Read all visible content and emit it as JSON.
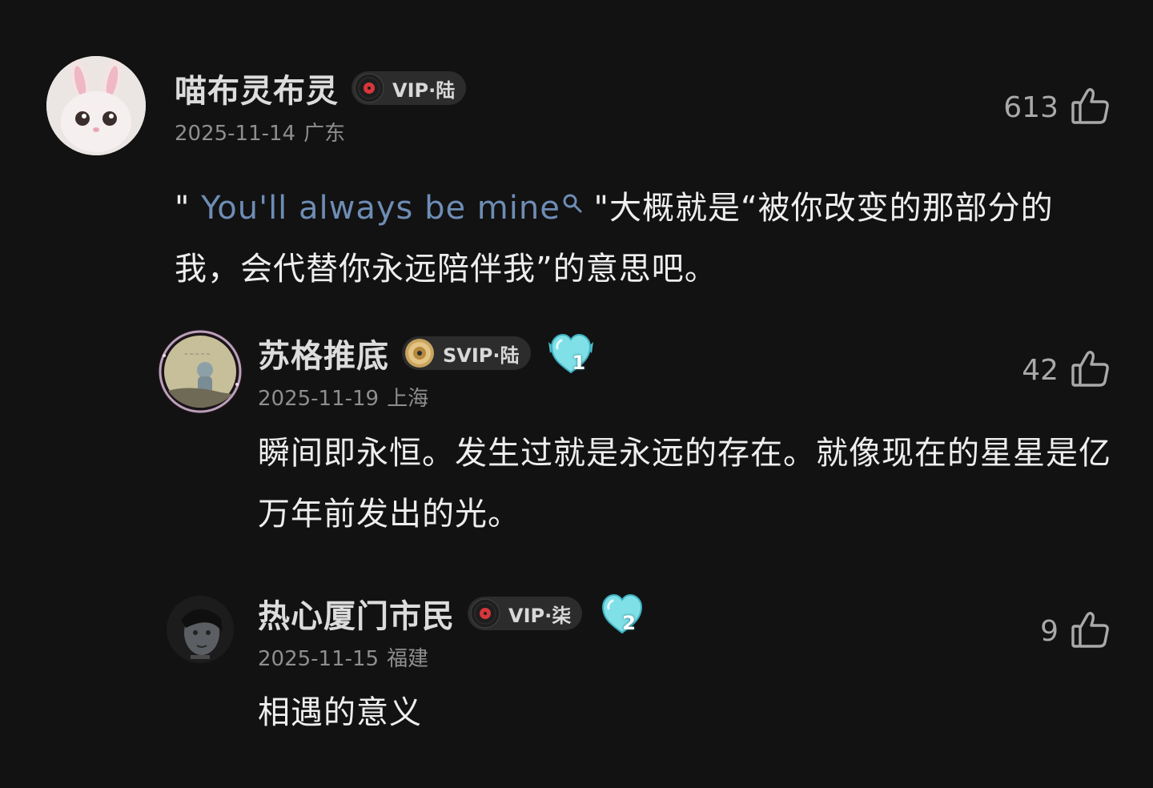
{
  "colors": {
    "background": "#121212",
    "username": "#dcdcdc",
    "meta": "#8e8e8e",
    "body_text": "#eeeeee",
    "keyword_link": "#6e8db5",
    "like_count": "#a9a9a9",
    "badge_bg": "#2c2c2c"
  },
  "comments": [
    {
      "username": "喵布灵布灵",
      "vip_label": "VIP·陆",
      "vip_icon": "vinyl-disc-icon",
      "date": "2025-11-14",
      "location": "广东",
      "likes": "613",
      "text_before_keyword": "\" ",
      "keyword": "You'll always be mine",
      "text_after_keyword": " \"大概就是“被你改变的那部分的我，会代替你永远陪伴我”的意思吧。"
    },
    {
      "username": "苏格推底",
      "vip_label": "SVIP·陆",
      "vip_icon": "gold-disc-icon",
      "fan_badge_level": "1",
      "date": "2025-11-19",
      "location": "上海",
      "likes": "42",
      "text": "瞬间即永恒。发生过就是永远的存在。就像现在的星星是亿万年前发出的光。"
    },
    {
      "username": "热心厦门市民",
      "vip_label": "VIP·柒",
      "vip_icon": "vinyl-disc-icon",
      "fan_badge_level": "2",
      "date": "2025-11-15",
      "location": "福建",
      "likes": "9",
      "text": "相遇的意义"
    }
  ]
}
